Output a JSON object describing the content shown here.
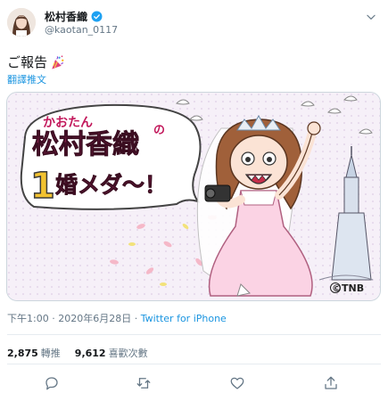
{
  "user": {
    "name": "松村香織",
    "handle": "@kaotan_0117"
  },
  "tweet": {
    "text": "ご報告",
    "translate_label": "翻譯推文"
  },
  "media": {
    "title_small": "かおたん",
    "title_main": "松村香織",
    "title_no": "の",
    "headline_1": "1",
    "headline_2": "婚メダ～！",
    "credit": "©TNB"
  },
  "meta": {
    "time": "下午1:00",
    "separator": " · ",
    "date": "2020年6月28日",
    "source": "Twitter for iPhone"
  },
  "stats": {
    "retweets_count": "2,875",
    "retweets_label": "轉推",
    "likes_count": "9,612",
    "likes_label": "喜歡次數"
  },
  "icons": {
    "reply": "reply-icon",
    "retweet": "retweet-icon",
    "like": "heart-icon",
    "share": "share-icon"
  },
  "colors": {
    "link": "#1b95e0",
    "muted": "#657786",
    "headline": "#7a1e45",
    "verified": "#1da1f2"
  }
}
